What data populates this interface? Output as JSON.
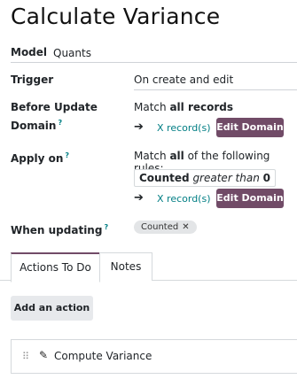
{
  "title": "Calculate Variance",
  "model": {
    "label": "Model",
    "value": "Quants"
  },
  "trigger": {
    "label": "Trigger",
    "value": "On create and edit"
  },
  "before_update": {
    "label_line1": "Before Update",
    "label_line2": "Domain",
    "help": "?",
    "match_prefix": "Match ",
    "match_bold": "all records",
    "records_link": "X record(s)",
    "edit_button": "Edit Domain"
  },
  "apply_on": {
    "label": "Apply on",
    "help": "?",
    "match_prefix": "Match ",
    "match_bold": "all",
    "match_suffix": " of the following rules:",
    "rule": {
      "field": "Counted",
      "operator": "greater than",
      "value": "0"
    },
    "records_link": "X record(s)",
    "edit_button": "Edit Domain"
  },
  "when_updating": {
    "label": "When updating",
    "help": "?",
    "tag": "Counted",
    "tag_remove": "✕"
  },
  "tabs": [
    {
      "label": "Actions To Do",
      "active": true
    },
    {
      "label": "Notes",
      "active": false
    }
  ],
  "add_action_label": "Add an action",
  "actions": [
    {
      "label": "Compute Variance"
    }
  ],
  "icons": {
    "arrow": "right-arrow-icon",
    "grip": "drag-handle-icon",
    "pencil": "pencil-icon"
  },
  "colors": {
    "primary": "#714b67",
    "link": "#017e84"
  }
}
